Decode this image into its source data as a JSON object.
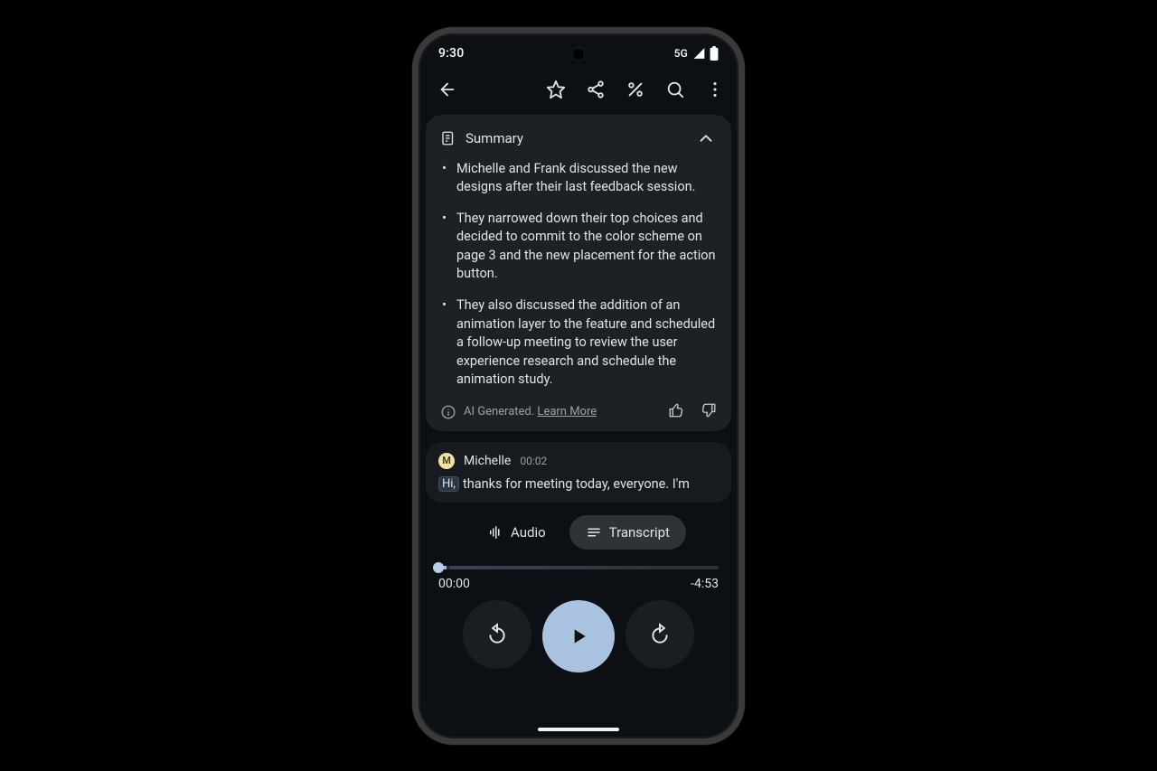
{
  "status": {
    "time": "9:30",
    "network": "5G"
  },
  "summary": {
    "title": "Summary",
    "bullets": [
      "Michelle and Frank discussed the new designs after their last feedback session.",
      "They narrowed down their top choices and decided to commit to the color scheme on page 3 and the new placement for the action button.",
      "They also discussed the addition of an animation layer to the feature and scheduled a follow-up meeting to review the user experience research and schedule the animation study."
    ],
    "ai_prefix": "AI Generated. ",
    "ai_link": "Learn More"
  },
  "transcript_snippet": {
    "speaker_initial": "M",
    "speaker": "Michelle",
    "timestamp": "00:02",
    "highlight": "Hi,",
    "rest": " thanks for meeting today, everyone. I'm"
  },
  "segmented": {
    "audio": "Audio",
    "transcript": "Transcript"
  },
  "player": {
    "elapsed": "00:00",
    "remaining": "-4:53"
  }
}
